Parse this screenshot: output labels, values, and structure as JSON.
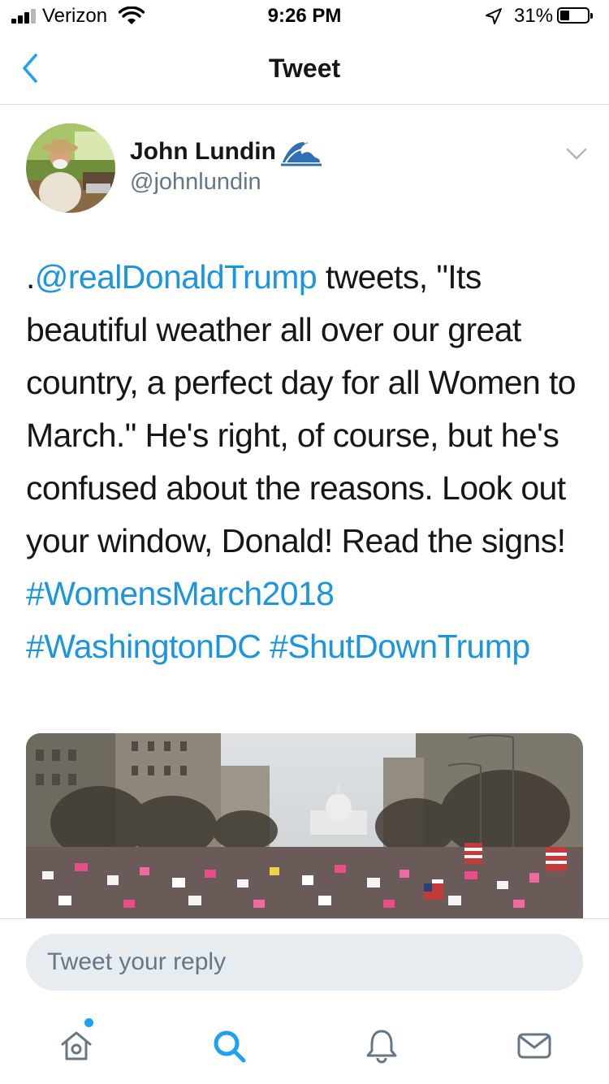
{
  "status_bar": {
    "carrier": "Verizon",
    "time": "9:26 PM",
    "battery_percent": "31%",
    "battery_level": 0.31
  },
  "nav": {
    "title": "Tweet",
    "back_icon": "chevron-left-icon"
  },
  "tweet": {
    "display_name": "John Lundin",
    "name_emoji": "water-wave-icon",
    "handle": "@johnlundin",
    "body_prefix": ".",
    "mention": "@realDonaldTrump",
    "body_text": " tweets, \"Its beautiful weather all over our great country, a perfect day for all Women to March.\" He's right, of course, but he's confused about the reasons. Look out your window, Donald! Read the signs!",
    "hashtags": [
      "#WomensMarch2018",
      "#WashingtonDC",
      "#ShutDownTrump"
    ]
  },
  "reply": {
    "placeholder": "Tweet your reply"
  },
  "tab_bar": {
    "items": [
      "home-icon",
      "search-icon",
      "notifications-icon",
      "messages-icon"
    ],
    "accent": "#1da1f2"
  },
  "colors": {
    "link": "#1b95e0",
    "secondary_text": "#657786",
    "input_bg": "#e6ecf0"
  }
}
